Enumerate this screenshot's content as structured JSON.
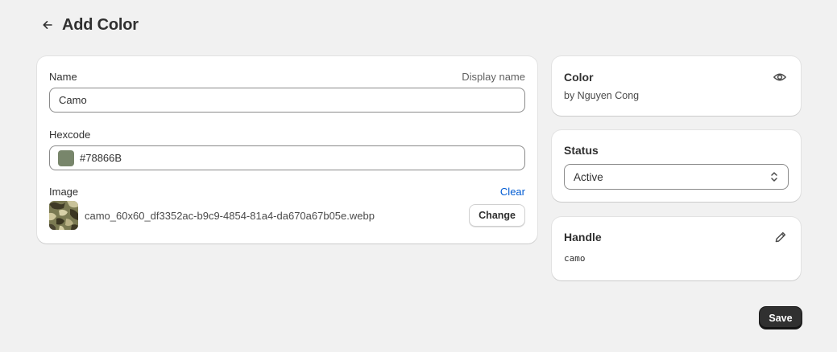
{
  "header": {
    "title": "Add Color",
    "back_icon": "arrow-left-icon"
  },
  "form": {
    "name": {
      "label": "Name",
      "display_name_label": "Display name",
      "value": "Camo"
    },
    "hexcode": {
      "label": "Hexcode",
      "value": "#78866B",
      "swatch_color": "#78866B"
    },
    "image": {
      "label": "Image",
      "clear_label": "Clear",
      "filename": "camo_60x60_df3352ac-b9c9-4854-81a4-da670a67b05e.webp",
      "change_label": "Change"
    }
  },
  "color_card": {
    "title": "Color",
    "byline": "by Nguyen Cong",
    "icon": "eye-icon"
  },
  "status_card": {
    "title": "Status",
    "selected": "Active",
    "icon": "select-chevrons-icon"
  },
  "handle_card": {
    "title": "Handle",
    "value": "camo",
    "icon": "pencil-icon"
  },
  "actions": {
    "save_label": "Save"
  },
  "colors": {
    "background": "#F1F1F1",
    "card": "#FFFFFF",
    "link": "#005BD3",
    "primary_button": "#303030"
  }
}
